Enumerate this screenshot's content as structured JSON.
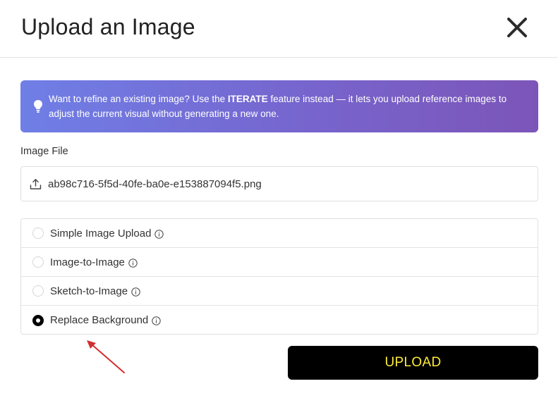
{
  "dialog": {
    "title": "Upload an Image"
  },
  "banner": {
    "text_before": "Want to refine an existing image? Use the ",
    "highlight": "ITERATE",
    "text_after": " feature instead — it lets you upload reference images to adjust the current visual without generating a new one.",
    "icon": "lightbulb-icon"
  },
  "image_file": {
    "label": "Image File",
    "filename": "ab98c716-5f5d-40fe-ba0e-e153887094f5.png",
    "icon": "upload-icon"
  },
  "modes": [
    {
      "label": "Simple Image Upload",
      "selected": false
    },
    {
      "label": "Image-to-Image",
      "selected": false
    },
    {
      "label": "Sketch-to-Image",
      "selected": false
    },
    {
      "label": "Replace Background",
      "selected": true
    }
  ],
  "actions": {
    "upload_label": "UPLOAD"
  },
  "colors": {
    "banner_start": "#6f7fe6",
    "banner_end": "#7c55b8",
    "upload_bg": "#000000",
    "upload_text": "#ffeb3b",
    "annotation_arrow": "#d32f2f"
  }
}
